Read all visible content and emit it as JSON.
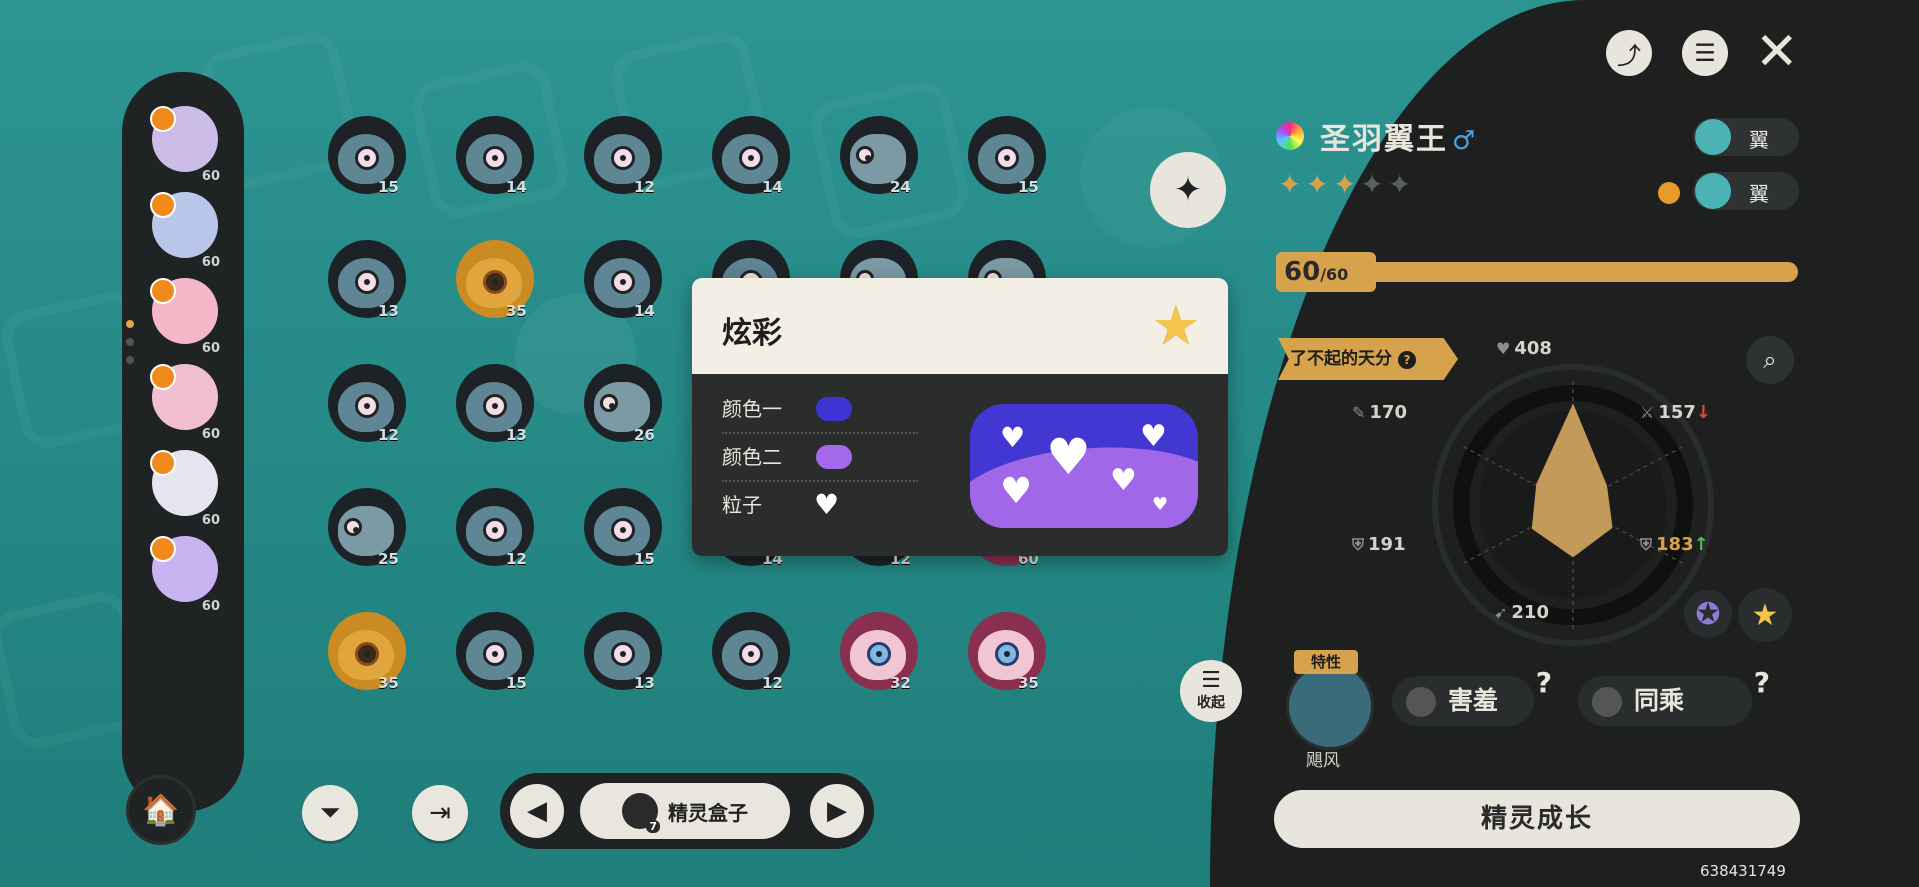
{
  "team": {
    "levels": [
      "60",
      "60",
      "60",
      "60",
      "60",
      "60"
    ],
    "avatars": [
      "#cbbde8",
      "#b9c8ea",
      "#f4b8c8",
      "#f1bfd0",
      "#e6e4ee",
      "#c9b4f1"
    ]
  },
  "grid": [
    {
      "level": "15",
      "kind": "eye"
    },
    {
      "level": "14",
      "kind": "eye"
    },
    {
      "level": "12",
      "kind": "eye"
    },
    {
      "level": "14",
      "kind": "eye"
    },
    {
      "level": "24",
      "kind": "crab"
    },
    {
      "level": "15",
      "kind": "eye"
    },
    {
      "level": "13",
      "kind": "eye"
    },
    {
      "level": "35",
      "kind": "gold"
    },
    {
      "level": "14",
      "kind": "eye"
    },
    {
      "level": "",
      "kind": "eye"
    },
    {
      "level": "",
      "kind": "crab"
    },
    {
      "level": "",
      "kind": "crab"
    },
    {
      "level": "12",
      "kind": "eye"
    },
    {
      "level": "13",
      "kind": "eye"
    },
    {
      "level": "26",
      "kind": "crab"
    },
    {
      "level": "",
      "kind": "eye"
    },
    {
      "level": "",
      "kind": "eye"
    },
    {
      "level": "",
      "kind": "eye"
    },
    {
      "level": "25",
      "kind": "crab"
    },
    {
      "level": "12",
      "kind": "eye"
    },
    {
      "level": "15",
      "kind": "eye"
    },
    {
      "level": "14",
      "kind": "eye"
    },
    {
      "level": "12",
      "kind": "eye"
    },
    {
      "level": "60",
      "kind": "bun"
    },
    {
      "level": "35",
      "kind": "gold"
    },
    {
      "level": "15",
      "kind": "eye"
    },
    {
      "level": "13",
      "kind": "eye"
    },
    {
      "level": "12",
      "kind": "eye"
    },
    {
      "level": "32",
      "kind": "bun"
    },
    {
      "level": "35",
      "kind": "bun"
    }
  ],
  "toolbar": {
    "box_label": "精灵盒子",
    "box_count": "7"
  },
  "popup": {
    "title": "炫彩",
    "rows": [
      {
        "label": "颜色一",
        "color": "#3d34d6"
      },
      {
        "label": "颜色二",
        "color": "#a468ec"
      },
      {
        "label": "粒子",
        "icon": "heart-icon"
      }
    ]
  },
  "side": {
    "collapse_label": "收起"
  },
  "creature": {
    "name": "圣羽翼王",
    "gender": "♂",
    "stars_filled": 3,
    "stars_total": 5,
    "types": [
      {
        "label": "翼",
        "color": "#4bb3b6"
      },
      {
        "label": "翼",
        "color": "#4bb3b6"
      }
    ],
    "level": "60",
    "level_max": "/60",
    "level_progress": 1.0,
    "talent_label": "了不起的天分",
    "stats": {
      "hp": "408",
      "attack": "157",
      "sp_defense": "183",
      "speed": "210",
      "defense": "191",
      "sp_attack": "170"
    },
    "trait_tag": "特性",
    "trait_name": "飓风",
    "skills": [
      "害羞",
      "同乘"
    ],
    "grow_button": "精灵成长"
  },
  "uid": "638431749",
  "colors": {
    "accent": "#d6a34c",
    "panel": "#1e2020",
    "background": "#2a8f8c"
  }
}
